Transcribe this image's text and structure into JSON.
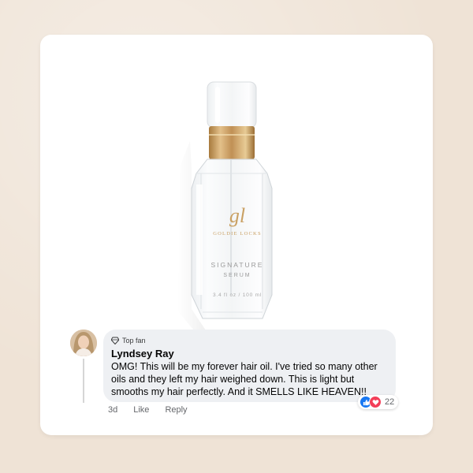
{
  "product": {
    "logo_monogram": "gl",
    "brand": "GOLDIE LOCKS",
    "name_line1": "SIGNATURE",
    "name_line2": "SERUM",
    "volume": "3.4 fl oz / 100 ml"
  },
  "comment": {
    "badge": "Top fan",
    "author": "Lyndsey Ray",
    "text": "OMG! This will be my forever hair oil. I've tried so many other oils and they left my hair weighed down. This is light but smooths my hair perfectly. And it SMELLS LIKE HEAVEN!!",
    "reaction_count": "22",
    "reactions": [
      "like-icon",
      "love-icon"
    ],
    "actions": {
      "time": "3d",
      "like": "Like",
      "reply": "Reply"
    }
  },
  "colors": {
    "background": "#efe3d6",
    "card": "#ffffff",
    "bubble": "#eef0f3",
    "gold": "#c9a063",
    "like_blue": "#1877f2",
    "love_red": "#f33e58"
  }
}
